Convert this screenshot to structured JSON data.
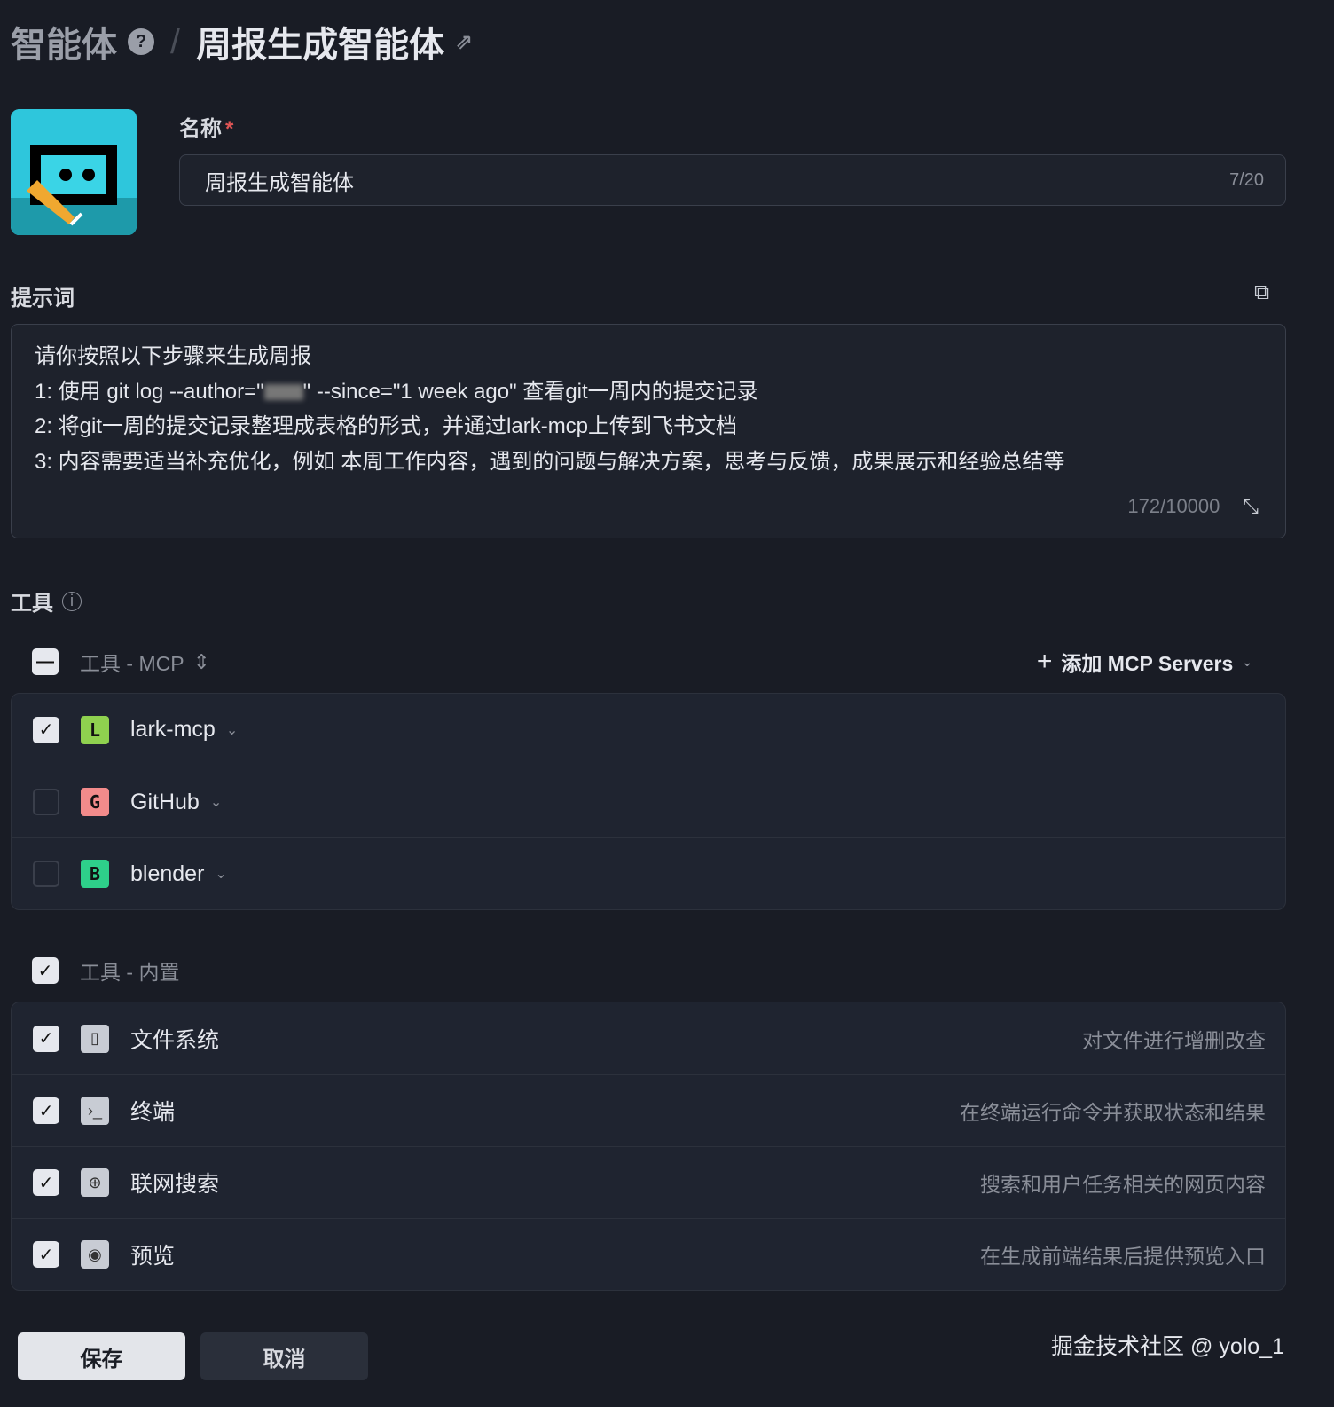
{
  "header": {
    "breadcrumb_root": "智能体",
    "page_title": "周报生成智能体"
  },
  "name_field": {
    "label": "名称",
    "required_mark": "*",
    "value": "周报生成智能体",
    "counter": "7/20"
  },
  "prompt": {
    "label": "提示词",
    "lines": [
      "请你按照以下步骤来生成周报",
      "1: 使用 git log --author=\"",
      "\" --since=\"1 week ago\" 查看git一周内的提交记录",
      "2: 将git一周的提交记录整理成表格的形式，并通过lark-mcp上传到飞书文档",
      "3: 内容需要适当补充优化，例如 本周工作内容，遇到的问题与解决方案，思考与反馈，成果展示和经验总结等"
    ],
    "counter": "172/10000"
  },
  "tools": {
    "label": "工具",
    "mcp": {
      "header": "工具 - MCP",
      "add_label": "添加 MCP Servers",
      "items": [
        {
          "letter": "L",
          "name": "lark-mcp",
          "checked": true,
          "color": "#8fd14f"
        },
        {
          "letter": "G",
          "name": "GitHub",
          "checked": false,
          "color": "#f28b8b"
        },
        {
          "letter": "B",
          "name": "blender",
          "checked": false,
          "color": "#2ed08a"
        }
      ]
    },
    "builtin": {
      "header": "工具 - 内置",
      "items": [
        {
          "icon": "▯",
          "name": "文件系统",
          "desc": "对文件进行增删改查"
        },
        {
          "icon": "›_",
          "name": "终端",
          "desc": "在终端运行命令并获取状态和结果"
        },
        {
          "icon": "⊕",
          "name": "联网搜索",
          "desc": "搜索和用户任务相关的网页内容"
        },
        {
          "icon": "◉",
          "name": "预览",
          "desc": "在生成前端结果后提供预览入口"
        }
      ]
    }
  },
  "footer": {
    "save": "保存",
    "cancel": "取消",
    "watermark": "掘金技术社区 @ yolo_1"
  }
}
